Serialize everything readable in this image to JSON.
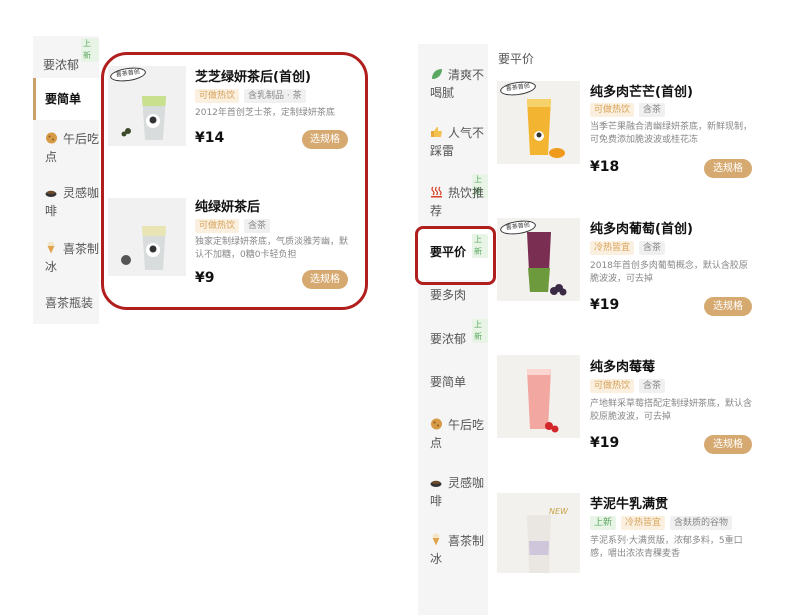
{
  "left_panel": {
    "sidebar": [
      {
        "label": "要浓郁",
        "badge": "上新"
      },
      {
        "label": "要简单"
      },
      {
        "label": "午后吃点"
      },
      {
        "label": "灵感咖啡"
      },
      {
        "label": "喜茶制冰"
      },
      {
        "label": "喜茶瓶装"
      }
    ],
    "products": [
      {
        "title": "芝芝绿妍茶后(首创)",
        "tags": [
          "可做热饮",
          "含乳制品 · 茶"
        ],
        "desc": "2012年首创芝士茶，定制绿妍茶底",
        "price": "¥14",
        "button": "选规格",
        "logo": "喜茶首创"
      },
      {
        "title": "纯绿妍茶后",
        "tags": [
          "可做热饮",
          "含茶"
        ],
        "desc": "独家定制绿妍茶底，气质淡雅芳幽，默认不加糖，0糖0卡轻负担",
        "price": "¥9",
        "button": "选规格"
      }
    ]
  },
  "right_panel": {
    "section_title": "要平价",
    "sidebar": [
      {
        "label": "清爽不喝腻"
      },
      {
        "label": "人气不踩雷"
      },
      {
        "label": "热饮推荐",
        "badge": "上新"
      },
      {
        "label": "要平价",
        "badge": "上新"
      },
      {
        "label": "要多肉"
      },
      {
        "label": "要浓郁",
        "badge": "上新"
      },
      {
        "label": "要简单"
      },
      {
        "label": "午后吃点"
      },
      {
        "label": "灵感咖啡"
      },
      {
        "label": "喜茶制冰"
      }
    ],
    "products": [
      {
        "title": "纯多肉芒芒(首创)",
        "tags": [
          "可做热饮",
          "含茶"
        ],
        "desc": "当季芒果融合清幽绿妍茶底，新鲜现制，可免费添加脆波波或桂花冻",
        "price": "¥18",
        "button": "选规格",
        "logo": "喜茶首创"
      },
      {
        "title": "纯多肉葡萄(首创)",
        "tags": [
          "冷热皆宜",
          "含茶"
        ],
        "desc": "2018年首创多肉葡萄概念，默认含胶原脆波波，可去掉",
        "price": "¥19",
        "button": "选规格",
        "logo": "喜茶首创"
      },
      {
        "title": "纯多肉莓莓",
        "tags": [
          "可做热饮",
          "含茶"
        ],
        "desc": "产地鲜采草莓搭配定制绿妍茶底，默认含胶原脆波波，可去掉",
        "price": "¥19",
        "button": "选规格"
      },
      {
        "title": "芋泥牛乳满贯",
        "tags": [
          "上新",
          "冷热皆宜",
          "含麸质的谷物"
        ],
        "desc": "芋泥系列·大满贯版，浓郁多料，5重口感，嚼出浓浓青稞麦香",
        "image_label": "NEW"
      }
    ]
  },
  "colors": {
    "accent": "#d6a971",
    "highlight": "#b01e1e",
    "tag_hot_bg": "#fbefdf",
    "new_green": "#5aa85f"
  }
}
